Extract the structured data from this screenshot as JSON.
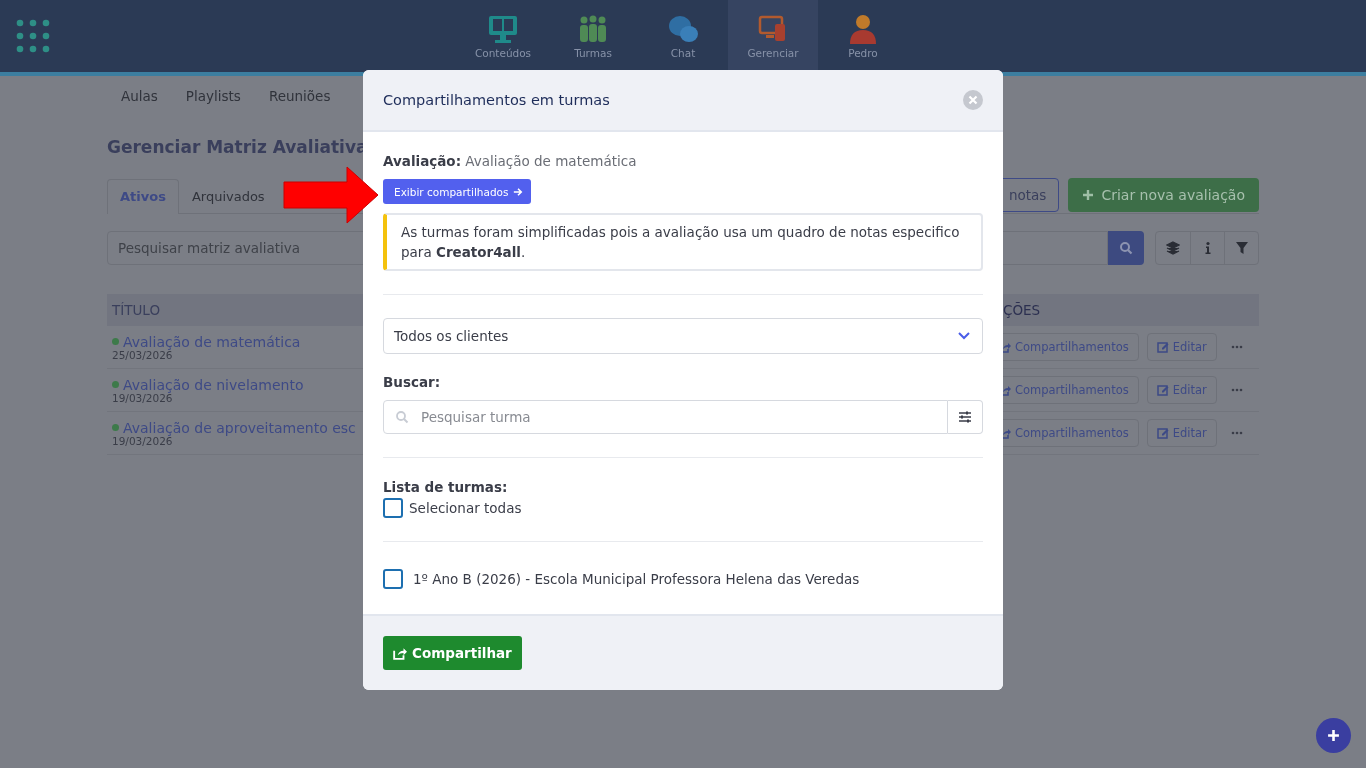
{
  "app_bar": {
    "nav": [
      {
        "label": "Conteúdos",
        "kind": "monitor",
        "selected": false
      },
      {
        "label": "Turmas",
        "kind": "people",
        "selected": false
      },
      {
        "label": "Chat",
        "kind": "chat",
        "selected": false
      },
      {
        "label": "Gerenciar",
        "kind": "devices",
        "selected": true
      },
      {
        "label": "Pedro",
        "kind": "avatar",
        "selected": false
      }
    ]
  },
  "subnav": [
    "Aulas",
    "Playlists",
    "Reuniões"
  ],
  "page_title": "Gerenciar Matriz Avaliativa",
  "tabs": [
    {
      "label": "Ativos",
      "selected": true
    },
    {
      "label": "Arquivados",
      "selected": false
    }
  ],
  "header_buttons": [
    {
      "label": "notas",
      "kind": "outline"
    },
    {
      "label": "Criar nova avaliação",
      "kind": "primary"
    }
  ],
  "search": {
    "placeholder": "Pesquisar matriz avaliativa"
  },
  "table": {
    "columns": [
      "TÍTULO",
      "ÇÕES"
    ],
    "rows": [
      {
        "title": "Avaliação de matemática",
        "date": "25/03/2026",
        "color": "#3d7a4a",
        "actions": [
          "Compartilhamentos",
          "Editar"
        ]
      },
      {
        "title": "Avaliação de nivelamento",
        "date": "19/03/2026",
        "color": "#3d7a4a",
        "actions": [
          "Compartilhamentos",
          "Editar"
        ]
      },
      {
        "title": "Avaliação de aproveitamento esc",
        "date": "19/03/2026",
        "color": "#3d7a4a",
        "actions": [
          "Compartilhamentos",
          "Editar"
        ]
      }
    ]
  },
  "modal": {
    "title": "Compartilhamentos em turmas",
    "assessment": "**Avaliação:** Avaliação de matemática",
    "show_shared_button": "Exibir compartilhados",
    "notice": "As turmas foram simplificadas pois a avaliação usa um quadro de notas especifico para **Creator4all**.",
    "client_select": "Todos os clientes",
    "search_label": "Buscar:",
    "search_placeholder": "Pesquisar turma",
    "list_label": "Lista de turmas:",
    "select_all": {
      "label": "Selecionar todas",
      "checked": false
    },
    "classes": [
      {
        "label": "1º Ano B (2026) - Escola Municipal Professora Helena das Veredas",
        "checked": false
      }
    ],
    "submit": "Compartilhar"
  }
}
